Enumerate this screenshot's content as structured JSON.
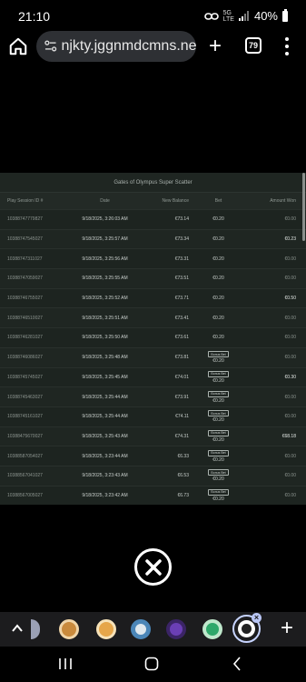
{
  "status_bar": {
    "time": "21:10",
    "network_top": "5G",
    "network_bottom": "LTE",
    "battery": "40%"
  },
  "browser": {
    "url": "njkty.jggnmdcmns.net",
    "tab_count": "79",
    "icons": [
      "home-icon",
      "site-settings-icon",
      "new-tab-icon",
      "tab-switcher-icon",
      "more-menu-icon"
    ]
  },
  "table": {
    "title": "Gates of Olympus Super Scatter",
    "columns": {
      "id": "Play Session ID #",
      "date": "Date",
      "balance": "New Balance",
      "bet": "Bet",
      "won": "Amount Won"
    },
    "rows": [
      {
        "id": "10388747779827",
        "date": "9/18/2025, 3:26:03 AM",
        "balance": "€73.14",
        "bet": "€0.20",
        "bonus": "",
        "won": "€0.00"
      },
      {
        "id": "10388747545027",
        "date": "9/18/2025, 3:25:57 AM",
        "balance": "€73.34",
        "bet": "€0.20",
        "bonus": "",
        "won": "€0.23"
      },
      {
        "id": "10388747311027",
        "date": "9/18/2025, 3:25:56 AM",
        "balance": "€73.31",
        "bet": "€0.20",
        "bonus": "",
        "won": "€0.00"
      },
      {
        "id": "10388747059027",
        "date": "9/18/2025, 3:25:55 AM",
        "balance": "€73.51",
        "bet": "€0.20",
        "bonus": "",
        "won": "€0.00"
      },
      {
        "id": "10388746755027",
        "date": "9/18/2025, 3:25:52 AM",
        "balance": "€73.71",
        "bet": "€0.20",
        "bonus": "",
        "won": "€0.50"
      },
      {
        "id": "10388746510027",
        "date": "9/18/2025, 3:25:51 AM",
        "balance": "€73.41",
        "bet": "€0.20",
        "bonus": "",
        "won": "€0.00"
      },
      {
        "id": "10388746281027",
        "date": "9/18/2025, 3:25:50 AM",
        "balance": "€73.61",
        "bet": "€0.20",
        "bonus": "",
        "won": "€0.00"
      },
      {
        "id": "10388746086027",
        "date": "9/18/2025, 3:25:48 AM",
        "balance": "€73.81",
        "bet": "€0.20",
        "bonus": "Bonus Bet",
        "won": "€0.00"
      },
      {
        "id": "10388745745027",
        "date": "9/18/2025, 3:25:45 AM",
        "balance": "€74.01",
        "bet": "€0.20",
        "bonus": "Bonus Bet",
        "won": "€0.30"
      },
      {
        "id": "10388745463027",
        "date": "9/18/2025, 3:25:44 AM",
        "balance": "€73.91",
        "bet": "€0.20",
        "bonus": "Bonus Bet",
        "won": "€0.00"
      },
      {
        "id": "10388745161027",
        "date": "9/18/2025, 3:25:44 AM",
        "balance": "€74.11",
        "bet": "€0.20",
        "bonus": "Bonus Bet",
        "won": "€0.00"
      },
      {
        "id": "10388475670027",
        "date": "9/18/2025, 3:25:43 AM",
        "balance": "€74.31",
        "bet": "€0.20",
        "bonus": "Bonus Bet",
        "won": "€68.18"
      },
      {
        "id": "10388587054027",
        "date": "9/18/2025, 3:23:44 AM",
        "balance": "€6.33",
        "bet": "€0.20",
        "bonus": "Bonus Bet",
        "won": "€0.00"
      },
      {
        "id": "10388567041027",
        "date": "9/18/2025, 3:23:43 AM",
        "balance": "€6.53",
        "bet": "€0.20",
        "bonus": "Bonus Bet",
        "won": "€0.00"
      },
      {
        "id": "10388567005027",
        "date": "9/18/2025, 3:23:42 AM",
        "balance": "€6.73",
        "bet": "€0.20",
        "bonus": "Bonus Bet",
        "won": "€0.00"
      },
      {
        "id": "10388566997027",
        "date": "9/18/2025, 3:23:41 AM",
        "balance": "€6.93",
        "bet": "€0.20",
        "bonus": "Bonus Bet",
        "won": "€0.00"
      },
      {
        "id": "10388566836027",
        "date": "9/18/2025, 3:23:40 AM",
        "balance": "€7.13",
        "bet": "€0.20",
        "bonus": "Bonus Bet",
        "won": "€0.05"
      },
      {
        "id": "10388566746027",
        "date": "9/18/2025, 3:23:38 AM",
        "balance": "€7.28",
        "bet": "€0.20",
        "bonus": "Bonus Bet",
        "won": "€0.00"
      },
      {
        "id": "10388566696027",
        "date": "9/18/2025, 3:23:36 AM",
        "balance": "€7.48",
        "bet": "€0.20",
        "bonus": "Bonus Bet",
        "won": "€0.05"
      }
    ]
  },
  "overlay": {
    "close_icon": "close-circle-icon"
  },
  "app_strip": {
    "apps": [
      {
        "name": "app-icon-1",
        "color": "#c98a3c"
      },
      {
        "name": "app-icon-2",
        "color": "#e6a64a"
      },
      {
        "name": "app-icon-3",
        "color": "#dfe8ee"
      },
      {
        "name": "app-icon-4",
        "color": "#6b3fb5"
      },
      {
        "name": "app-icon-5",
        "color": "#2ea86a"
      },
      {
        "name": "app-icon-active",
        "color": "#ffffff"
      }
    ],
    "close_badge": "×",
    "add_label": "+"
  },
  "nav_bar": {
    "icons": [
      "recents-icon",
      "home-nav-icon",
      "back-icon"
    ]
  },
  "colors": {
    "page_bg": "#000000",
    "table_bg": "#1f2622",
    "url_pill": "#2e3034"
  }
}
